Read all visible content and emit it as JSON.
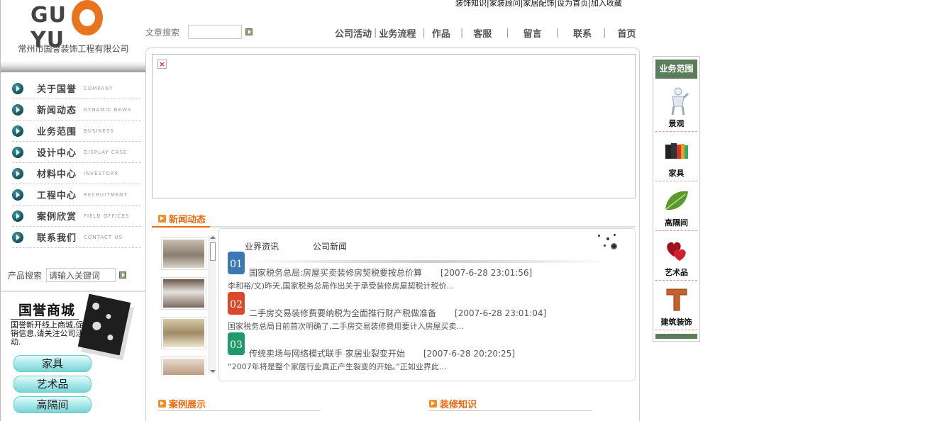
{
  "brand": {
    "logo_text_left": "GU",
    "logo_text_right": "YU",
    "company_name": "常州市国誉装饰工程有限公司",
    "accent": "#e8741e"
  },
  "top_links": {
    "text": "装饰知识|家装顾问|家居配饰|设为首页|加入收藏"
  },
  "article_search": {
    "label": "文章搜索",
    "placeholder": ""
  },
  "top_nav": [
    {
      "label": "公司活动"
    },
    {
      "label": "业务流程"
    },
    {
      "label": "作品"
    },
    {
      "label": "客服"
    },
    {
      "label": "留言"
    },
    {
      "label": "联系"
    },
    {
      "label": "首页"
    }
  ],
  "left_nav": [
    {
      "zh": "关于国誉",
      "en": "company"
    },
    {
      "zh": "新闻动态",
      "en": "dynamic news"
    },
    {
      "zh": "业务范围",
      "en": "business"
    },
    {
      "zh": "设计中心",
      "en": "display case"
    },
    {
      "zh": "材料中心",
      "en": "investors"
    },
    {
      "zh": "工程中心",
      "en": "recruitment"
    },
    {
      "zh": "案例欣赏",
      "en": "field offices"
    },
    {
      "zh": "联系我们",
      "en": "contact us"
    }
  ],
  "product_search": {
    "label": "产品搜索",
    "value": "请输入关键词"
  },
  "mall": {
    "title": "国誉商城",
    "text": "国誉新开线上商城,促销信息,请关注公司活动.",
    "buttons": [
      "家具",
      "艺术品",
      "高隔间"
    ]
  },
  "sections": {
    "news": "新闻动态",
    "cases": "案例展示",
    "knowledge": "装修知识"
  },
  "news": {
    "tabs": [
      "业界资讯",
      "公司新闻"
    ],
    "items": [
      {
        "num": "01",
        "color": "#3c78b4",
        "title": "国家税务总局:房屋买卖装修房契税要按总价算",
        "time": "[2007-6-28 23:01:56]",
        "summary": "李和裕/文)昨天,国家税务总局作出关于承受装修房屋契税计税价..."
      },
      {
        "num": "02",
        "color": "#d94a2a",
        "title": "二手房交易装修费要纳税为全面推行财产税做准备",
        "time": "[2007-6-28 23:01:04]",
        "summary": "国家税务总局日前首次明确了,二手房交易装修费用要计入房屋买卖..."
      },
      {
        "num": "03",
        "color": "#1f9b6b",
        "title": "传统卖场与网络模式联手 家居业裂变开始",
        "time": "[2007-6-28 20:20:25]",
        "summary": "“2007年将是整个家居行业真正产生裂变的开始。”正如业界此..."
      }
    ]
  },
  "right": {
    "title": "业务范围",
    "items": [
      {
        "label": "景观",
        "icon": "figure-icon"
      },
      {
        "label": "家具",
        "icon": "books-icon"
      },
      {
        "label": "高隔间",
        "icon": "leaf-icon"
      },
      {
        "label": "艺术品",
        "icon": "hearts-icon"
      },
      {
        "label": "建筑装饰",
        "icon": "letter-t-icon"
      }
    ]
  }
}
